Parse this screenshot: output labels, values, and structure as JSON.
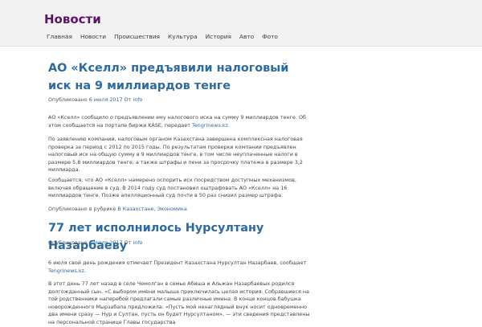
{
  "site": {
    "title": "Новости"
  },
  "nav": [
    {
      "label": "Главная"
    },
    {
      "label": "Новости"
    },
    {
      "label": "Происшествия"
    },
    {
      "label": "Культура"
    },
    {
      "label": "История"
    },
    {
      "label": "Авто"
    },
    {
      "label": "Фото"
    }
  ],
  "posts": [
    {
      "title": "АО «Кселл» предъявили налоговый иск на 9 миллиардов тенге",
      "meta_prefix": "Опубликовано",
      "date": "6 июля 2017",
      "author_prefix": "От",
      "author": "info",
      "p1_text": "АО «Кселл» сообщило о предъявлении ему налогового иска на сумму 9 миллиардов тенге. Об этом сообщается на портале биржи KASE, передает",
      "p1_link": "Tengrinews.kz",
      "p1_end": ".",
      "p2": "По заявлению компании, налоговым органом Казахстана завершена комплексная налоговая проверка за период с 2012 по 2015 годы. По результатам проверки компании предъявлен налоговый иск на общую сумму в 9 миллиардов тенге, в том числе неуплаченные налоги в размере 5,8 миллиардов тенге, а также штрафы и пени за просрочку платежа в размере 3,2 миллиарда.",
      "p3": "Сообщается, что АО «Кселл» намерено оспорить иск посредством доступных механизмов, включая обращение в суд. В 2014 году суд постановил оштрафовать АО «Кселл» на 16 миллиардов тенге. Позже апелляционный суд почти в 50 раз снизил размер штрафа.",
      "cats_prefix": "Опубликовано в рубрике",
      "cat1": "В Казахстане",
      "cat_sep": ",",
      "cat2": "Экономика"
    },
    {
      "title": "77 лет исполнилось Нурсултану Назарбаеву",
      "meta_prefix": "Опубликовано",
      "date": "6 июля 2017",
      "author_prefix": "От",
      "author": "info",
      "p1_text": "6 июля свой день рождения отмечает Президент Казахстана Нурсултан Назарбаев, сообщает",
      "p1_link": "Tengrinews.kz",
      "p1_end": ".",
      "p2": "В этот день 77 лет назад в селе Чемолган в семье Абиша и Альжан Назарбаевых родился долгожданный сын. «С выбором имени малыша приключилась целая история. Собравшиеся на той родственники наперебой предлагали самые различные имена. В конце концов бабушка новорожденного Мырзабала предложила: «Пусть мой ненаглядный внук носит одновременно два имени сразу — Нур и Султан, пусть он будет Нурсултаном», — эти сведения представлены на персональной странице Главы государства"
    }
  ]
}
